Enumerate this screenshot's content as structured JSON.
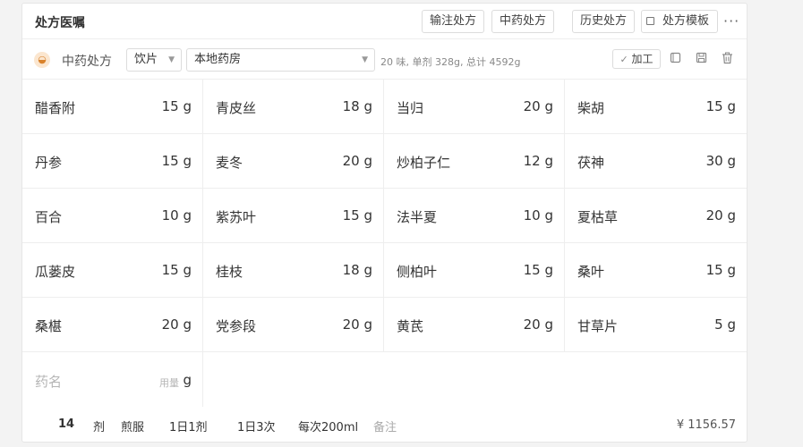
{
  "header": {
    "title": "处方医嘱",
    "buttons": [
      "输注处方",
      "中药处方",
      "历史处方",
      "处方模板"
    ]
  },
  "toolbar": {
    "rx_type": "中药处方",
    "form_select": "饮片",
    "pharmacy_select": "本地药房",
    "summary": "20 味, 单剂 328g, 总计 4592g",
    "process_label": "加工",
    "check_glyph": "✓"
  },
  "herbs": [
    {
      "name": "醋香附",
      "dose": "15 g"
    },
    {
      "name": "青皮丝",
      "dose": "18 g"
    },
    {
      "name": "当归",
      "dose": "20 g"
    },
    {
      "name": "柴胡",
      "dose": "15 g"
    },
    {
      "name": "丹参",
      "dose": "15 g"
    },
    {
      "name": "麦冬",
      "dose": "20 g"
    },
    {
      "name": "炒柏子仁",
      "dose": "12 g"
    },
    {
      "name": "茯神",
      "dose": "30 g"
    },
    {
      "name": "百合",
      "dose": "10 g"
    },
    {
      "name": "紫苏叶",
      "dose": "15 g"
    },
    {
      "name": "法半夏",
      "dose": "10 g"
    },
    {
      "name": "夏枯草",
      "dose": "20 g"
    },
    {
      "name": "瓜蒌皮",
      "dose": "15 g"
    },
    {
      "name": "桂枝",
      "dose": "18 g"
    },
    {
      "name": "侧柏叶",
      "dose": "15 g"
    },
    {
      "name": "桑叶",
      "dose": "15 g"
    },
    {
      "name": "桑椹",
      "dose": "20 g"
    },
    {
      "name": "党参段",
      "dose": "20 g"
    },
    {
      "name": "黄芪",
      "dose": "20 g"
    },
    {
      "name": "甘草片",
      "dose": "5 g"
    }
  ],
  "new_herb": {
    "name_placeholder": "药名",
    "qty_placeholder": "用量",
    "unit": "g"
  },
  "footer": {
    "count": "14",
    "count_unit": "剂",
    "usage": "煎服",
    "daily_dose": "1日1剂",
    "daily_times": "1日3次",
    "per_time": "每次200ml",
    "remark_placeholder": "备注",
    "price": "¥ 1156.57"
  },
  "icons": {
    "herb": "mortar-icon",
    "more": "more-horizontal-icon",
    "template": "template-icon",
    "copy": "copy-icon",
    "save": "save-icon",
    "delete": "trash-icon"
  }
}
